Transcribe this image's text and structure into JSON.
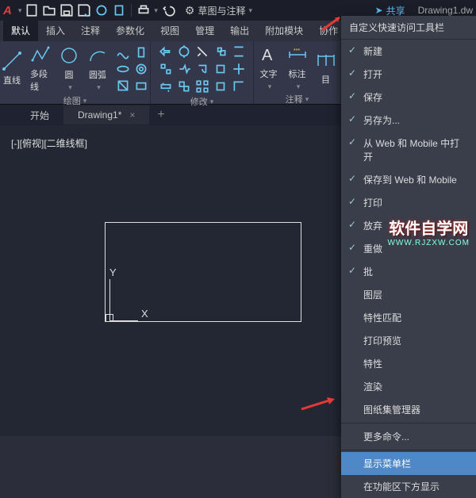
{
  "titlebar": {
    "workspace_label": "草图与注释",
    "share_label": "共享",
    "doc_name": "Drawing1.dw"
  },
  "ribbon_tabs": [
    "默认",
    "插入",
    "注释",
    "参数化",
    "视图",
    "管理",
    "输出",
    "附加模块",
    "协作"
  ],
  "panels": {
    "draw": {
      "btns": [
        "直线",
        "多段线",
        "圆",
        "圆弧"
      ],
      "label": "绘图"
    },
    "modify": {
      "label": "修改"
    },
    "annot": {
      "btns": [
        "文字",
        "标注",
        "目"
      ],
      "label": "注释"
    }
  },
  "doc_tabs": {
    "start": "开始",
    "file": "Drawing1*"
  },
  "drawing": {
    "ucs": "[-][俯视][二维线框]",
    "y": "Y",
    "x": "X"
  },
  "menu": {
    "header": "自定义快速访问工具栏",
    "checked": [
      "新建",
      "打开",
      "保存",
      "另存为...",
      "从 Web 和 Mobile 中打开",
      "保存到 Web 和 Mobile",
      "打印",
      "放弃",
      "重做"
    ],
    "unchecked_partial": "批",
    "unchecked_after": [
      "图层",
      "特性匹配",
      "打印预览",
      "特性",
      "渲染",
      "图纸集管理器"
    ],
    "more": "更多命令...",
    "showmenu": "显示菜单栏",
    "below": "在功能区下方显示"
  },
  "watermark": {
    "line1": "软件自学网",
    "line2": "WWW.RJZXW.COM"
  }
}
